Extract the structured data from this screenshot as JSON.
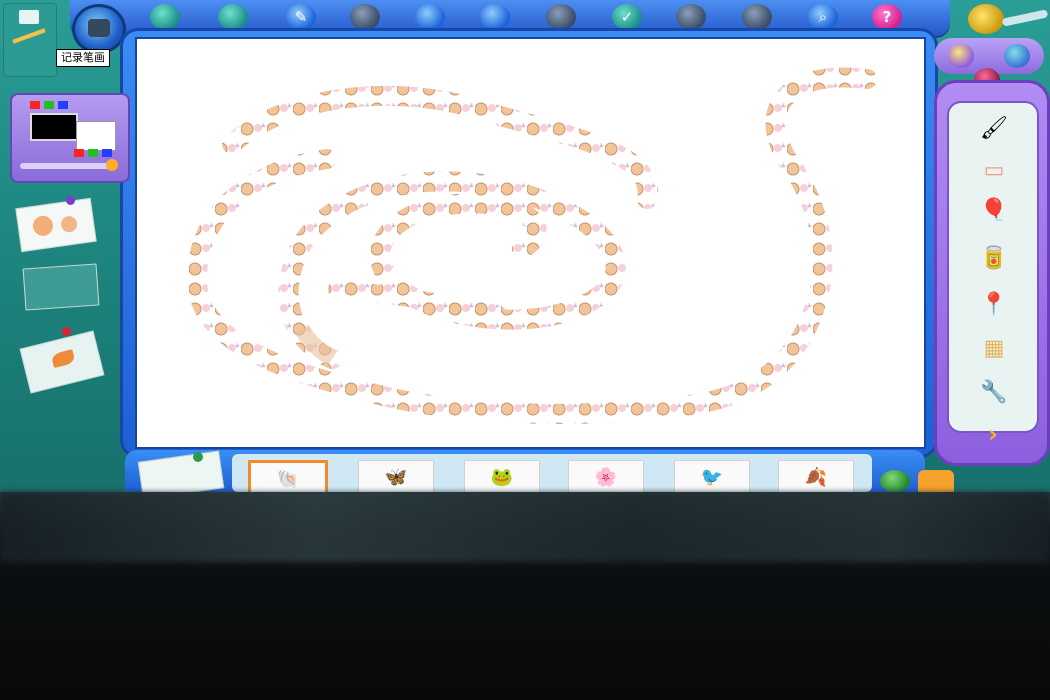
{
  "tooltip": {
    "record_label": "记录笔画"
  },
  "toolbar": {
    "icons": [
      "teal-ball-icon",
      "teal-ball-icon",
      "pencil-icon",
      "disabled-icon",
      "blue-drop-icon",
      "blue-drop-icon",
      "disabled-icon",
      "check-icon",
      "disabled-icon",
      "disabled-icon",
      "magnifier-icon",
      "help-icon"
    ],
    "help_label": "?"
  },
  "palette": {
    "swatches": [
      "#ff2020",
      "#20c020",
      "#2040ff",
      "#ff2020",
      "#20c020",
      "#2040ff"
    ],
    "current_color": "#000000",
    "secondary_color": "#ffffff"
  },
  "right_tools": [
    "brush-icon",
    "eraser-icon",
    "paint-bucket-balloon-icon",
    "paint-can-icon",
    "pushpin-icon",
    "stamp-grid-icon",
    "spray-nozzle-icon"
  ],
  "right_tools_glyphs": [
    "🖌",
    "▭",
    "🎈",
    "🥫",
    "📍",
    "▦",
    "🔧"
  ],
  "bottom_thumbnails": [
    {
      "name": "thumbnail-shells",
      "glyph": "🐚",
      "selected": true
    },
    {
      "name": "thumbnail-butterflies",
      "glyph": "🦋",
      "selected": false
    },
    {
      "name": "thumbnail-frogs",
      "glyph": "🐸",
      "selected": false
    },
    {
      "name": "thumbnail-flowers",
      "glyph": "🌸",
      "selected": false
    },
    {
      "name": "thumbnail-birds",
      "glyph": "🐦",
      "selected": false
    },
    {
      "name": "thumbnail-leaves",
      "glyph": "🍂",
      "selected": false
    }
  ],
  "colors": {
    "frame_blue": "#2e72e6",
    "app_teal": "#1f8a83",
    "panel_purple": "#9b74e6",
    "shell_orange": "#f0b98a",
    "shell_pink": "#f6c7cf",
    "starfish": "#c9b3d8"
  }
}
